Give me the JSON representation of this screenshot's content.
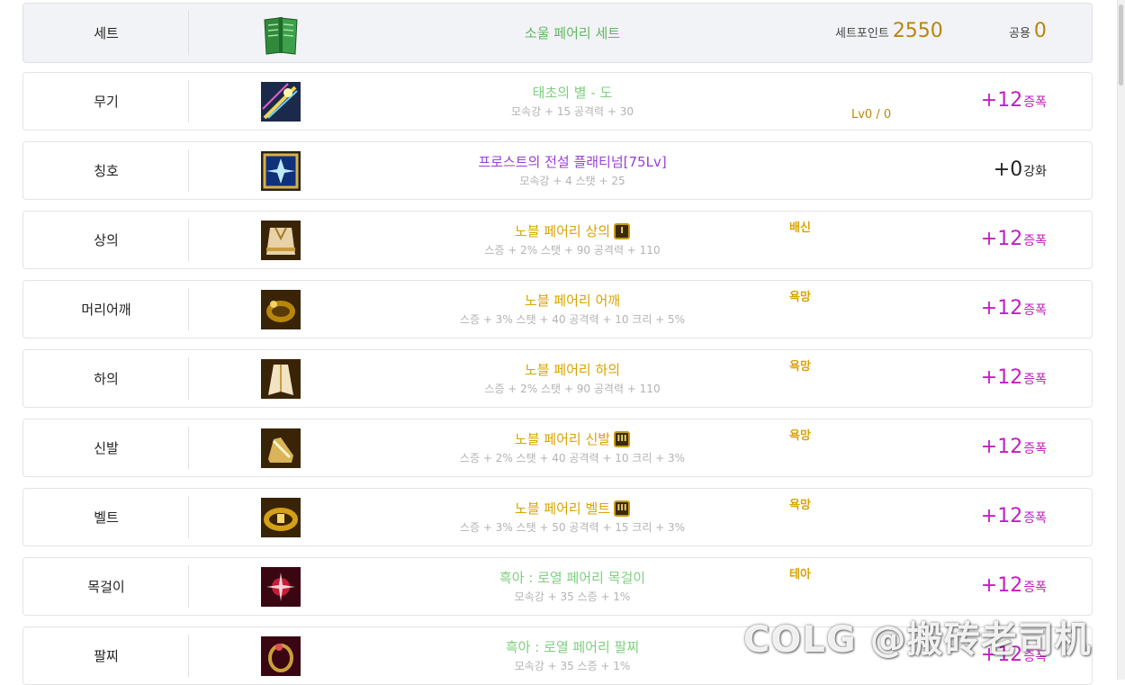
{
  "set": {
    "slot": "세트",
    "name": "소울 페어리 세트",
    "name_color": "#5fb85f",
    "point_label": "세트포인트",
    "point_value": "2550",
    "common_label": "공용",
    "common_value": "0",
    "icon": "green-book-icon"
  },
  "items": [
    {
      "slot": "무기",
      "name": "태초의 별 - 도",
      "name_color": "#7fcf7f",
      "stats": "모속강 + 15 공격력 + 30",
      "tag": "",
      "level": "Lv0 / 0",
      "reinforce_num": "+12",
      "reinforce_unit": "증폭",
      "icon": "star-sword-icon",
      "grade": ""
    },
    {
      "slot": "칭호",
      "name": "프로스트의 전설 플래티넘[75Lv]",
      "name_color": "#9a3ed6",
      "stats": "모속강 + 4 스탯 + 25",
      "tag": "",
      "level": "",
      "reinforce_num": "+0",
      "reinforce_unit": "강화",
      "icon": "frost-title-icon",
      "grade": ""
    },
    {
      "slot": "상의",
      "name": "노블 페어리 상의",
      "name_color": "#d9a400",
      "stats": "스증 + 2% 스탯 + 90 공격력 + 110",
      "tag": "배신",
      "level": "",
      "reinforce_num": "+12",
      "reinforce_unit": "증폭",
      "icon": "noble-top-icon",
      "grade": "I"
    },
    {
      "slot": "머리어깨",
      "name": "노블 페어리 어깨",
      "name_color": "#d9a400",
      "stats": "스증 + 3% 스탯 + 40 공격력 + 10 크리 + 5%",
      "tag": "욕망",
      "level": "",
      "reinforce_num": "+12",
      "reinforce_unit": "증폭",
      "icon": "noble-shoulder-icon",
      "grade": ""
    },
    {
      "slot": "하의",
      "name": "노블 페어리 하의",
      "name_color": "#d9a400",
      "stats": "스증 + 2% 스탯 + 90 공격력 + 110",
      "tag": "욕망",
      "level": "",
      "reinforce_num": "+12",
      "reinforce_unit": "증폭",
      "icon": "noble-bottom-icon",
      "grade": ""
    },
    {
      "slot": "신발",
      "name": "노블 페어리 신발",
      "name_color": "#d9a400",
      "stats": "스증 + 2% 스탯 + 40 공격력 + 10 크리 + 3%",
      "tag": "욕망",
      "level": "",
      "reinforce_num": "+12",
      "reinforce_unit": "증폭",
      "icon": "noble-shoes-icon",
      "grade": "III"
    },
    {
      "slot": "벨트",
      "name": "노블 페어리 벨트",
      "name_color": "#d9a400",
      "stats": "스증 + 3% 스탯 + 50 공격력 + 15 크리 + 3%",
      "tag": "욕망",
      "level": "",
      "reinforce_num": "+12",
      "reinforce_unit": "증폭",
      "icon": "noble-belt-icon",
      "grade": "III"
    },
    {
      "slot": "목걸이",
      "name": "흑아 : 로열 페어리 목걸이",
      "name_color": "#7fcf7f",
      "stats": "모속강 + 35 스증 + 1%",
      "tag": "테아",
      "level": "",
      "reinforce_num": "+12",
      "reinforce_unit": "증폭",
      "icon": "royal-necklace-icon",
      "grade": ""
    },
    {
      "slot": "팔찌",
      "name": "흑아 : 로열 페어리 팔찌",
      "name_color": "#7fcf7f",
      "stats": "모속강 + 35 스증 + 1%",
      "tag": "",
      "level": "",
      "reinforce_num": "+12",
      "reinforce_unit": "증폭",
      "icon": "royal-bracelet-icon",
      "grade": ""
    }
  ],
  "watermark": "COLG @搬砖老司机"
}
